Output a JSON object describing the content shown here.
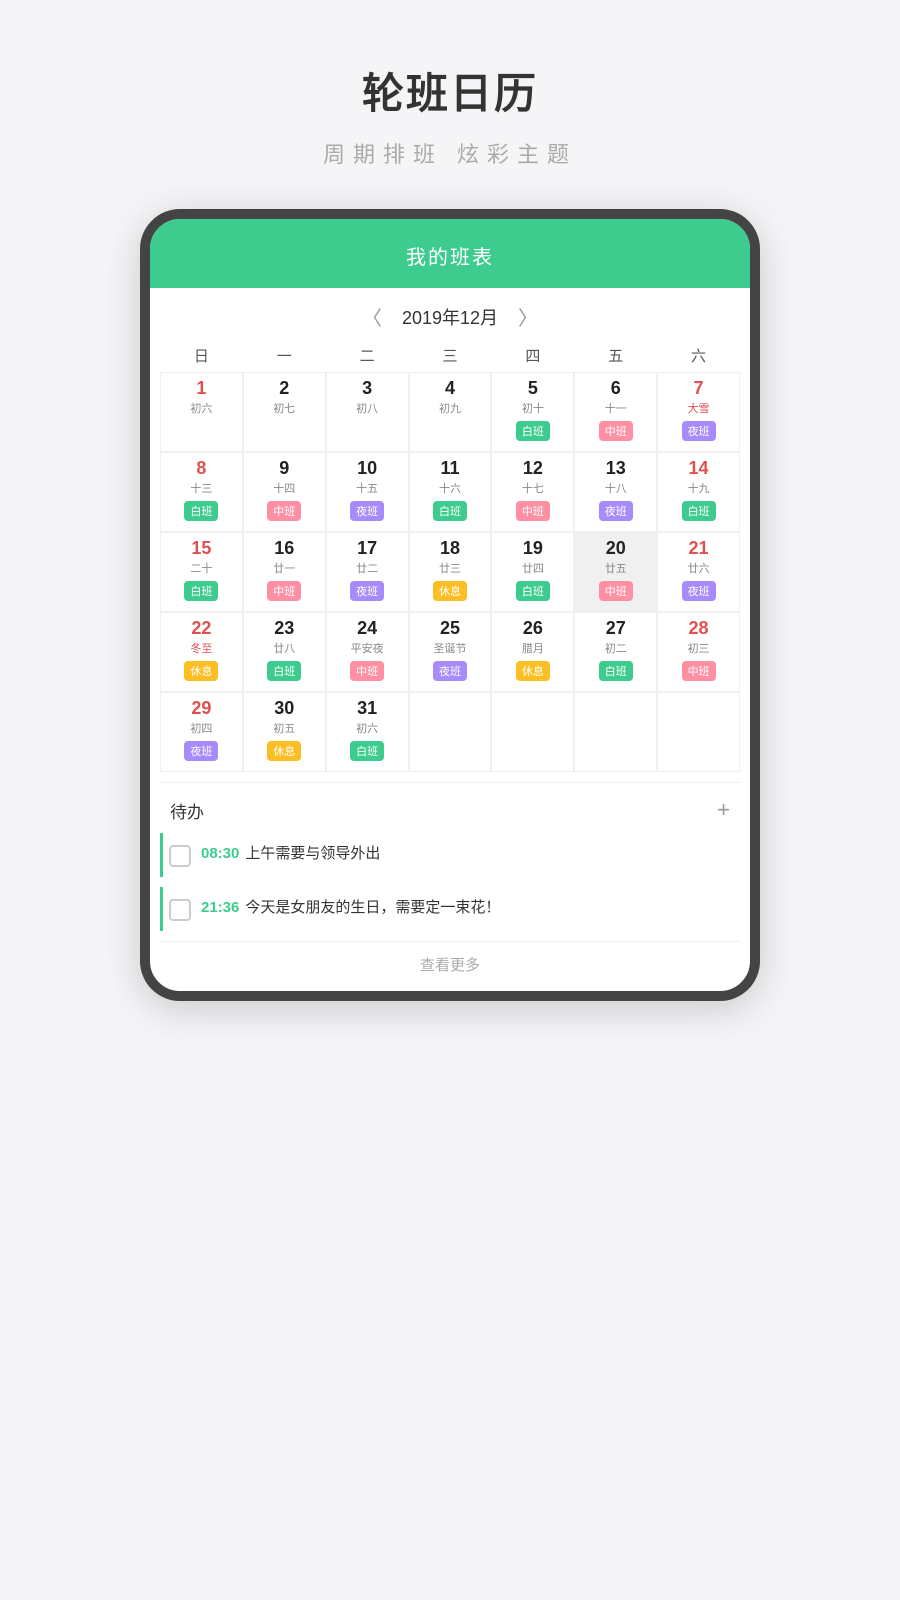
{
  "appTitle": "轮班日历",
  "appSubtitle": "周期排班  炫彩主题",
  "header": {
    "title": "我的班表"
  },
  "nav": {
    "prevArrow": "〈",
    "nextArrow": "〉",
    "monthLabel": "2019年12月"
  },
  "weekdays": [
    "日",
    "一",
    "二",
    "三",
    "四",
    "五",
    "六"
  ],
  "days": [
    {
      "num": "1",
      "red": true,
      "lunar": "初六",
      "badge": null,
      "today": false,
      "empty": false
    },
    {
      "num": "2",
      "red": false,
      "lunar": "初七",
      "badge": null,
      "today": false,
      "empty": false
    },
    {
      "num": "3",
      "red": false,
      "lunar": "初八",
      "badge": null,
      "today": false,
      "empty": false
    },
    {
      "num": "4",
      "red": false,
      "lunar": "初九",
      "badge": null,
      "today": false,
      "empty": false
    },
    {
      "num": "5",
      "red": false,
      "lunar": "初十",
      "badge": "白班",
      "badgeType": "bai",
      "today": false,
      "empty": false
    },
    {
      "num": "6",
      "red": false,
      "lunar": "十一",
      "badge": "中班",
      "badgeType": "zhong",
      "today": false,
      "empty": false
    },
    {
      "num": "7",
      "red": true,
      "lunar": "大雪",
      "lunarSpecial": true,
      "badge": "夜班",
      "badgeType": "ye",
      "today": false,
      "empty": false
    },
    {
      "num": "8",
      "red": true,
      "lunar": "十三",
      "badge": "白班",
      "badgeType": "bai",
      "today": false,
      "empty": false
    },
    {
      "num": "9",
      "red": false,
      "lunar": "十四",
      "badge": "中班",
      "badgeType": "zhong",
      "today": false,
      "empty": false
    },
    {
      "num": "10",
      "red": false,
      "lunar": "十五",
      "badge": "夜班",
      "badgeType": "ye",
      "today": false,
      "empty": false
    },
    {
      "num": "11",
      "red": false,
      "lunar": "十六",
      "badge": "白班",
      "badgeType": "bai",
      "today": false,
      "empty": false
    },
    {
      "num": "12",
      "red": false,
      "lunar": "十七",
      "badge": "中班",
      "badgeType": "zhong",
      "today": false,
      "empty": false
    },
    {
      "num": "13",
      "red": false,
      "lunar": "十八",
      "badge": "夜班",
      "badgeType": "ye",
      "today": false,
      "empty": false
    },
    {
      "num": "14",
      "red": true,
      "lunar": "十九",
      "badge": "白班",
      "badgeType": "bai",
      "today": false,
      "empty": false
    },
    {
      "num": "15",
      "red": true,
      "lunar": "二十",
      "badge": "白班",
      "badgeType": "bai",
      "today": false,
      "empty": false
    },
    {
      "num": "16",
      "red": false,
      "lunar": "廿一",
      "badge": "中班",
      "badgeType": "zhong",
      "today": false,
      "empty": false
    },
    {
      "num": "17",
      "red": false,
      "lunar": "廿二",
      "badge": "夜班",
      "badgeType": "ye",
      "today": false,
      "empty": false
    },
    {
      "num": "18",
      "red": false,
      "lunar": "廿三",
      "badge": "休息",
      "badgeType": "xiu",
      "today": false,
      "empty": false
    },
    {
      "num": "19",
      "red": false,
      "lunar": "廿四",
      "badge": "白班",
      "badgeType": "bai",
      "today": false,
      "empty": false
    },
    {
      "num": "20",
      "red": false,
      "lunar": "廿五",
      "badge": "中班",
      "badgeType": "zhong",
      "today": true,
      "empty": false
    },
    {
      "num": "21",
      "red": true,
      "lunar": "廿六",
      "badge": "夜班",
      "badgeType": "ye",
      "today": false,
      "empty": false
    },
    {
      "num": "22",
      "red": true,
      "lunar": "冬至",
      "lunarSpecial": true,
      "badge": "休息",
      "badgeType": "xiu",
      "today": false,
      "empty": false
    },
    {
      "num": "23",
      "red": false,
      "lunar": "廿八",
      "badge": "白班",
      "badgeType": "bai",
      "today": false,
      "empty": false
    },
    {
      "num": "24",
      "red": false,
      "lunar": "平安夜",
      "lunarSpecial": false,
      "badge": "中班",
      "badgeType": "zhong",
      "today": false,
      "empty": false
    },
    {
      "num": "25",
      "red": false,
      "lunar": "圣诞节",
      "lunarSpecial": false,
      "badge": "夜班",
      "badgeType": "ye",
      "today": false,
      "empty": false
    },
    {
      "num": "26",
      "red": false,
      "lunar": "腊月",
      "badge": "休息",
      "badgeType": "xiu",
      "today": false,
      "empty": false
    },
    {
      "num": "27",
      "red": false,
      "lunar": "初二",
      "badge": "白班",
      "badgeType": "bai",
      "today": false,
      "empty": false
    },
    {
      "num": "28",
      "red": true,
      "lunar": "初三",
      "badge": "中班",
      "badgeType": "zhong",
      "today": false,
      "empty": false
    },
    {
      "num": "29",
      "red": true,
      "lunar": "初四",
      "badge": "夜班",
      "badgeType": "ye",
      "today": false,
      "empty": false
    },
    {
      "num": "30",
      "red": false,
      "lunar": "初五",
      "badge": "休息",
      "badgeType": "xiu",
      "today": false,
      "empty": false
    },
    {
      "num": "31",
      "red": false,
      "lunar": "初六",
      "badge": "白班",
      "badgeType": "bai",
      "today": false,
      "empty": false
    }
  ],
  "todo": {
    "title": "待办",
    "addLabel": "+",
    "items": [
      {
        "time": "08:30",
        "text": "上午需要与领导外出"
      },
      {
        "time": "21:36",
        "text": "今天是女朋友的生日，需要定一束花！"
      }
    ],
    "viewMore": "查看更多"
  }
}
